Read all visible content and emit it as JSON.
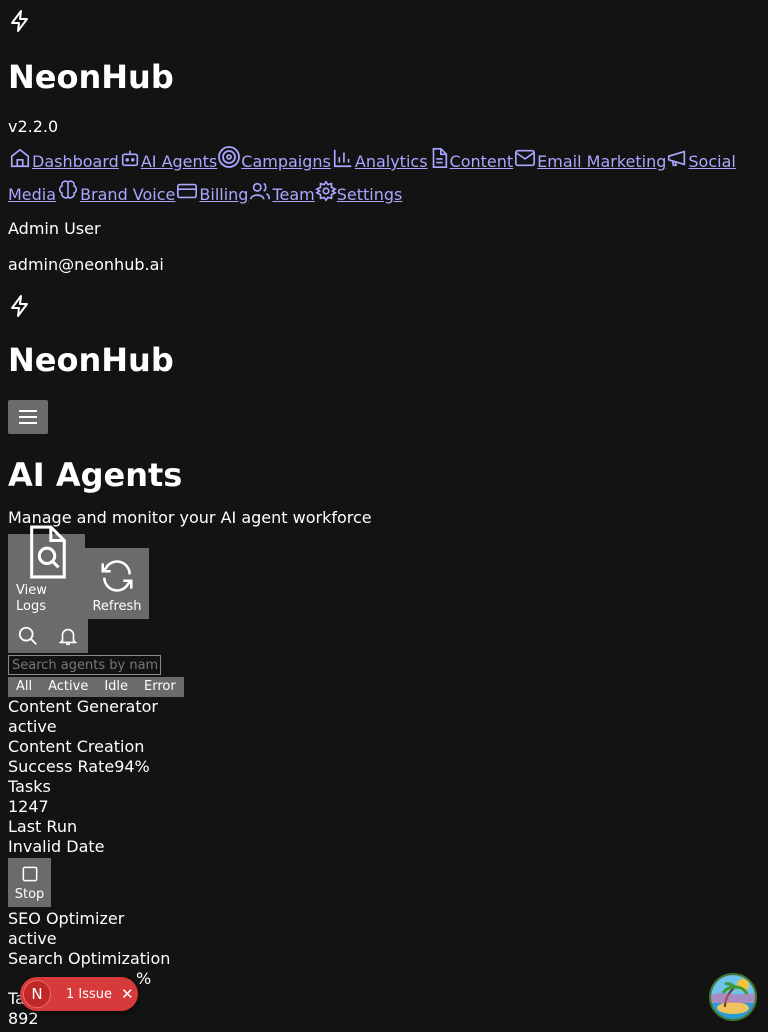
{
  "app": {
    "name": "NeonHub",
    "version": "v2.2.0"
  },
  "nav": {
    "items": [
      {
        "label": "Dashboard",
        "icon": "home-icon"
      },
      {
        "label": "AI Agents",
        "icon": "bot-icon"
      },
      {
        "label": "Campaigns",
        "icon": "target-icon"
      },
      {
        "label": "Analytics",
        "icon": "bar-chart-icon"
      },
      {
        "label": "Content",
        "icon": "file-text-icon"
      },
      {
        "label": "Email Marketing",
        "icon": "mail-icon"
      },
      {
        "label": "Social Media",
        "icon": "megaphone-icon"
      },
      {
        "label": "Brand Voice",
        "icon": "brain-icon"
      },
      {
        "label": "Billing",
        "icon": "credit-card-icon"
      },
      {
        "label": "Team",
        "icon": "users-icon"
      },
      {
        "label": "Settings",
        "icon": "gear-icon"
      }
    ]
  },
  "user": {
    "name": "Admin User",
    "email": "admin@neonhub.ai"
  },
  "page": {
    "title": "AI Agents",
    "subtitle": "Manage and monitor your AI agent workforce"
  },
  "actions": {
    "view_logs": "View Logs",
    "refresh": "Refresh"
  },
  "search": {
    "placeholder": "Search agents by name"
  },
  "filters": [
    "All",
    "Active",
    "Idle",
    "Error"
  ],
  "agents": [
    {
      "name": "Content Generator",
      "status": "active",
      "category": "Content Creation",
      "success_label": "Success Rate",
      "success_value": "94%",
      "tasks_label": "Tasks",
      "tasks_value": "1247",
      "last_run_label": "Last Run",
      "last_run_value": "Invalid Date",
      "stop_label": "Stop"
    },
    {
      "name": "SEO Optimizer",
      "status": "active",
      "category": "Search Optimization",
      "success_partial": "%",
      "tasks_label": "Tasks",
      "tasks_value": "892"
    }
  ],
  "issues": {
    "logo_letter": "N",
    "label": "1 Issue",
    "close": "✕"
  }
}
